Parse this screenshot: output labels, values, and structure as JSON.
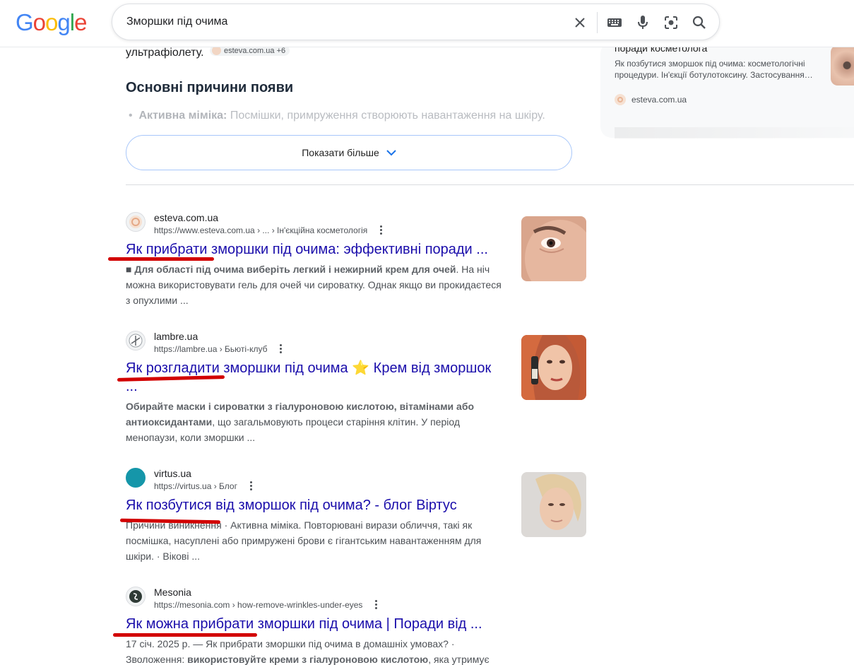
{
  "header": {
    "logo": [
      "G",
      "o",
      "o",
      "g",
      "l",
      "e"
    ],
    "logo_colors": [
      "#4285f4",
      "#ea4335",
      "#fbbc05",
      "#4285f4",
      "#34a853",
      "#ea4335"
    ],
    "query": "Зморшки під очима"
  },
  "overview": {
    "ultraviolet_text": "ультрафіолету.",
    "chip_label": "esteva.com.ua",
    "chip_count": "+6",
    "section_heading": "Основні причини появи",
    "bullet_bold": "Активна міміка:",
    "bullet_text": " Посмішки, примруження створюють навантаження на шкіру.",
    "show_more_label": "Показати більше"
  },
  "side_card": {
    "title": "поради косметолога",
    "snippet": "Як позбутися зморшок під очима: косметологічні процедури. Ін'єкції ботулотоксину. Застосування…",
    "source": "esteva.com.ua"
  },
  "results": [
    {
      "site": "esteva.com.ua",
      "url": "https://www.esteva.com.ua › ... › Ін'єкційна косметологія",
      "title": "Як прибрати зморшки під очима: эффективні поради ...",
      "title_cont": "",
      "snippet_pre": "■ ",
      "snippet_bold": "Для області під очима виберіть легкий і нежирний крем для очей",
      "snippet_post": ". На ніч можна використовувати гель для очей чи сироватку. Однак якщо ви прокидаєтеся з опухлими ..."
    },
    {
      "site": "lambre.ua",
      "url": "https://lambre.ua › Бьюті-клуб",
      "title": "Як розгладити зморшки під очима ⭐ Крем від зморшок",
      "title_cont": "...",
      "snippet_pre": "",
      "snippet_bold": "Обирайте маски і сироватки з гіалуроновою кислотою, вітамінами або антиоксидантами",
      "snippet_post": ", що загальмовують процеси старіння клітин. У період менопаузи, коли зморшки ..."
    },
    {
      "site": "virtus.ua",
      "url": "https://virtus.ua › Блог",
      "title": "Як позбутися від зморшок під очима? - блог Віртус",
      "title_cont": "",
      "snippet_pre": "Причини виникнення · ",
      "snippet_bold": "",
      "snippet_post": "Активна міміка. Повторювані вирази обличчя, такі як посмішка, насуплені або примружені брови є гігантським навантаженням для шкіри. · Вікові ..."
    },
    {
      "site": "Mesonia",
      "url": "https://mesonia.com › how-remove-wrinkles-under-eyes",
      "title": "Як можна прибрати зморшки під очима | Поради від ...",
      "title_cont": "",
      "snippet_pre": "17 січ. 2025 р. — Як прибрати зморшки під очима в домашніх умовах? · Зволоження: ",
      "snippet_bold": "використовуйте креми з гіалуроновою кислотою",
      "snippet_post": ", яка утримує вологу та розгладжує ..."
    }
  ]
}
